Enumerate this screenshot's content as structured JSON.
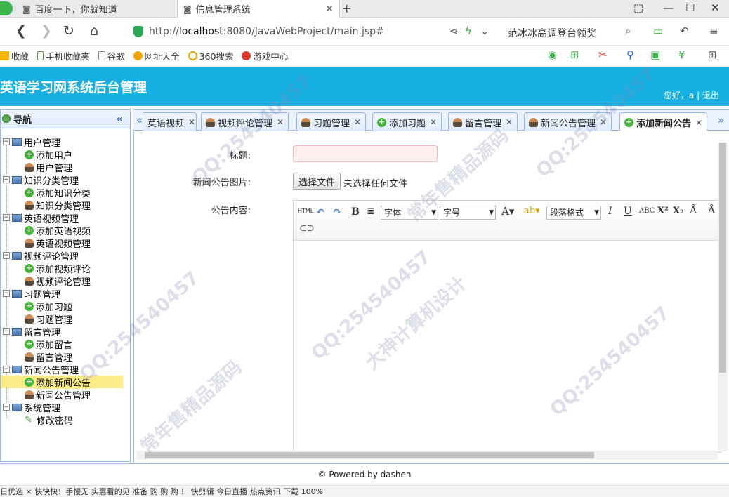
{
  "browser": {
    "tabs": [
      {
        "title": "百度一下，你就知道"
      },
      {
        "title": "信息管理系统"
      }
    ],
    "url_prefix": "http://",
    "url_host": "localhost",
    "url_rest": ":8080/JavaWebProject/main.jsp#",
    "search_text": "范冰冰高调登台领奖",
    "bookmarks": [
      "收藏",
      "手机收藏夹",
      "谷歌",
      "网址大全",
      "360搜索",
      "游戏中心"
    ]
  },
  "app": {
    "title": "英语学习网系统后台管理",
    "greeting": "您好，a",
    "separator": "|",
    "logout": "退出"
  },
  "sidebar": {
    "title": "导航",
    "groups": [
      {
        "label": "用户管理",
        "items": [
          "添加用户",
          "用户管理"
        ]
      },
      {
        "label": "知识分类管理",
        "items": [
          "添加知识分类",
          "知识分类管理"
        ]
      },
      {
        "label": "英语视频管理",
        "items": [
          "添加英语视频",
          "英语视频管理"
        ]
      },
      {
        "label": "视频评论管理",
        "items": [
          "添加视频评论",
          "视频评论管理"
        ]
      },
      {
        "label": "习题管理",
        "items": [
          "添加习题",
          "习题管理"
        ]
      },
      {
        "label": "留言管理",
        "items": [
          "添加留言",
          "留言管理"
        ]
      },
      {
        "label": "新闻公告管理",
        "items": [
          "添加新闻公告",
          "新闻公告管理"
        ]
      },
      {
        "label": "系统管理",
        "items": [
          "修改密码"
        ]
      }
    ],
    "selected": "添加新闻公告"
  },
  "content_tabs": [
    "英语视频",
    "视频评论管理",
    "习题管理",
    "添加习题",
    "留言管理",
    "新闻公告管理",
    "添加新闻公告"
  ],
  "form": {
    "title_label": "标题:",
    "title_value": "",
    "image_label": "新闻公告图片:",
    "file_button": "选择文件",
    "file_status": "未选择任何文件",
    "content_label": "公告内容:",
    "editor": {
      "html": "HTML",
      "font": "字体",
      "size": "字号",
      "paragraph": "段落格式"
    }
  },
  "footer": {
    "text": "© Powered by dashen"
  },
  "statusbar": {
    "text": "日优选   × 快快快！手慢无 实惠看的见 准备 购 购 购 ！        快剪辑   今日直播   热点资讯       下载          100%"
  },
  "watermark": {
    "qq": "QQ:254540457",
    "a": "大神计算机设计",
    "b": "常年售精品源码"
  }
}
